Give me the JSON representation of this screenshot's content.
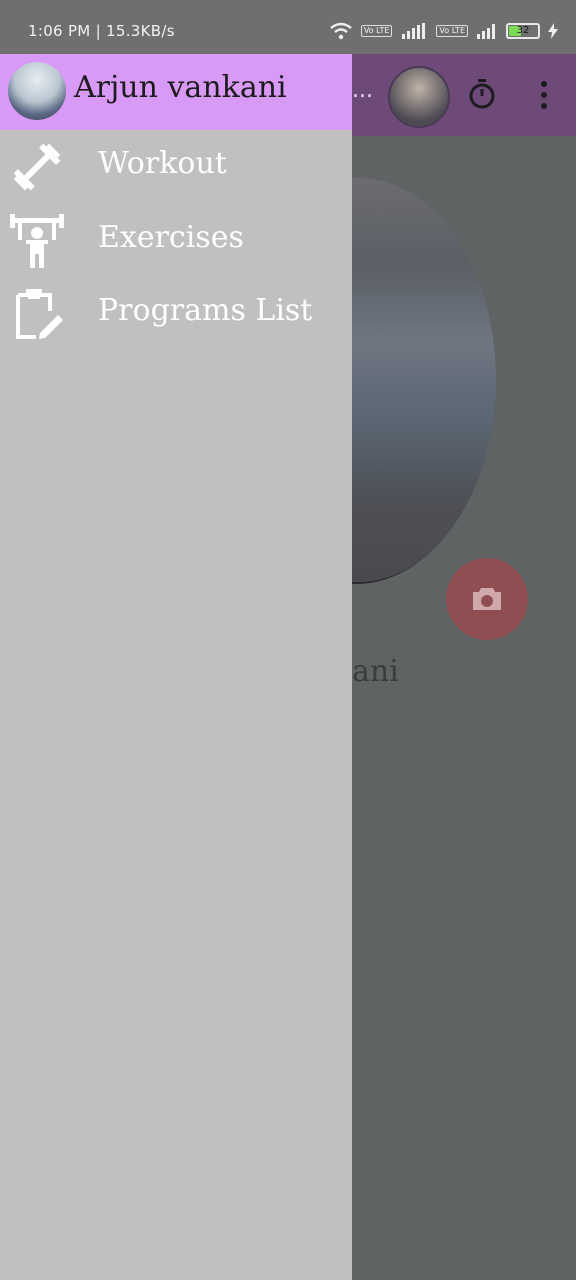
{
  "status_bar": {
    "time": "1:06 PM | 15.3KB/s",
    "network_tags": [
      "Vo LTE",
      "Vo LTE"
    ],
    "battery_level": "32"
  },
  "background_app": {
    "title_ellipsis": "...",
    "profile_name_partial": "ani"
  },
  "drawer": {
    "user_name": "Arjun vankani",
    "items": [
      {
        "label": "Workout",
        "icon": "dumbbell-icon"
      },
      {
        "label": "Exercises",
        "icon": "weightlifter-icon"
      },
      {
        "label": "Programs List",
        "icon": "clipboard-edit-icon"
      }
    ]
  },
  "colors": {
    "drawer_header": "#d999f7",
    "drawer_bg": "#c0c0c0",
    "appbar_dimmed": "#6d4a77",
    "fab_dimmed": "#8f4f52"
  }
}
